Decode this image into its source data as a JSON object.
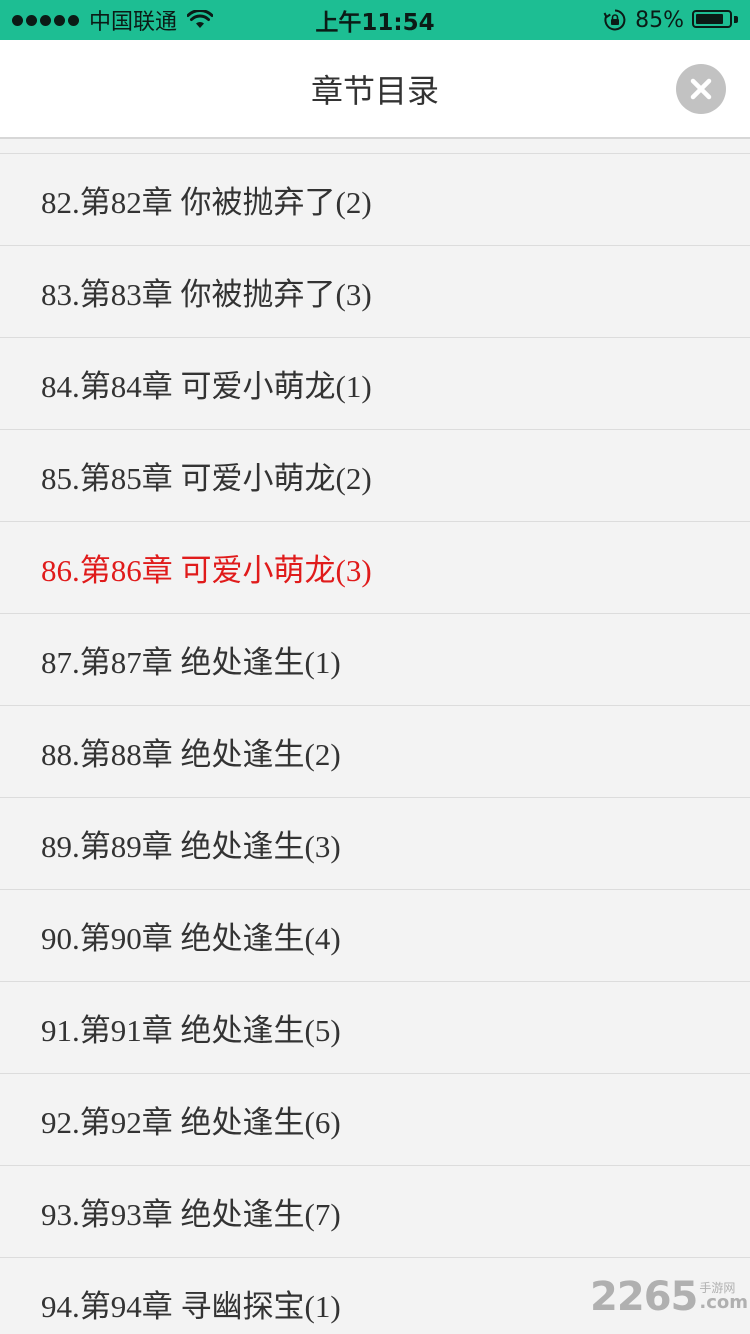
{
  "status_bar": {
    "carrier": "中国联通",
    "time": "上午11:54",
    "battery_percent": "85%",
    "battery_level": 0.85,
    "icons": [
      "signal-dots-icon",
      "wifi-icon",
      "lock-rotation-icon",
      "battery-icon"
    ]
  },
  "header": {
    "title": "章节目录",
    "close_icon": "close-icon"
  },
  "chapters": [
    {
      "label": "82.第82章 你被抛弃了(2)"
    },
    {
      "label": "83.第83章 你被抛弃了(3)"
    },
    {
      "label": "84.第84章 可爱小萌龙(1)"
    },
    {
      "label": "85.第85章 可爱小萌龙(2)"
    },
    {
      "label": "86.第86章 可爱小萌龙(3)",
      "current": true
    },
    {
      "label": "87.第87章 绝处逢生(1)"
    },
    {
      "label": "88.第88章 绝处逢生(2)"
    },
    {
      "label": "89.第89章 绝处逢生(3)"
    },
    {
      "label": "90.第90章 绝处逢生(4)"
    },
    {
      "label": "91.第91章 绝处逢生(5)"
    },
    {
      "label": "92.第92章 绝处逢生(6)"
    },
    {
      "label": "93.第93章 绝处逢生(7)"
    },
    {
      "label": "94.第94章 寻幽探宝(1)"
    }
  ],
  "watermark": {
    "digits": "2265",
    "cn": "手游网",
    "suffix": ".com"
  },
  "colors": {
    "status_bar": "#1dbe93",
    "current_chapter": "#e01b1b",
    "list_background": "#f3f3f3"
  }
}
